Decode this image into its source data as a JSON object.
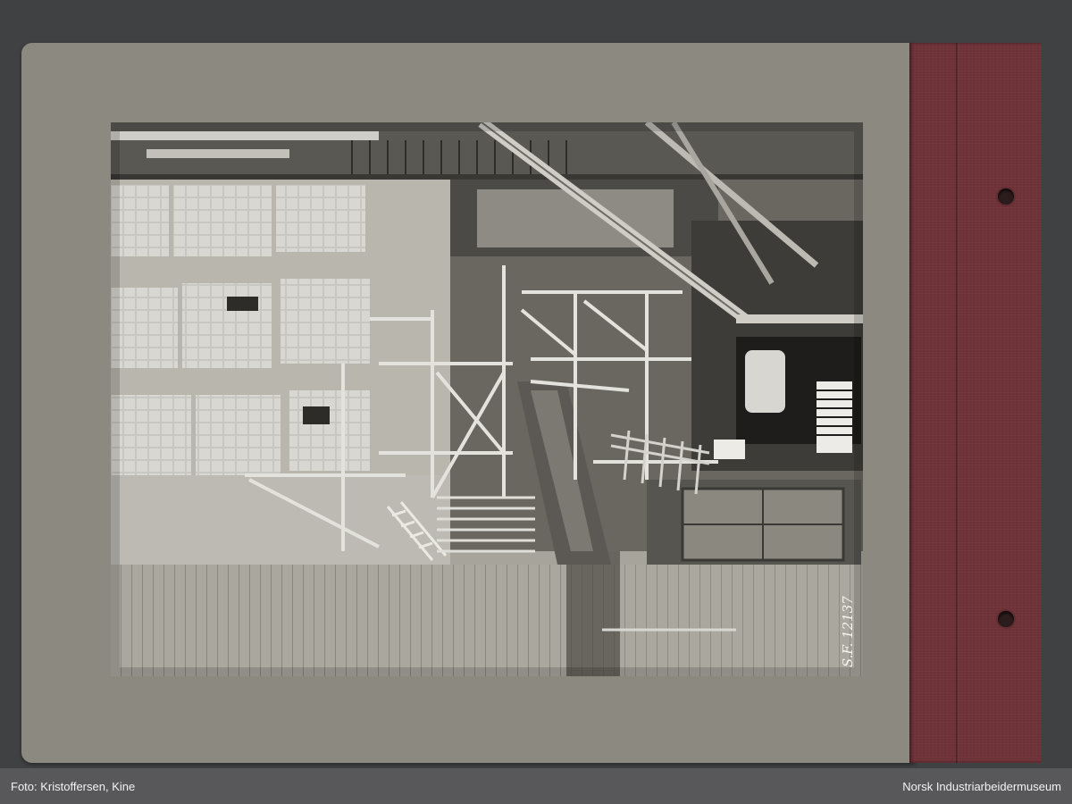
{
  "photo": {
    "description_alt": "",
    "handwritten_number": "S.F. 12137"
  },
  "footer": {
    "credit": "Foto: Kristoffersen, Kine",
    "institution": "Norsk Industriarbeidermuseum"
  },
  "colors": {
    "background": "#404143",
    "album_page": "#8c8a80",
    "binding": "#6e3238",
    "caption_bar": "#58585a"
  }
}
